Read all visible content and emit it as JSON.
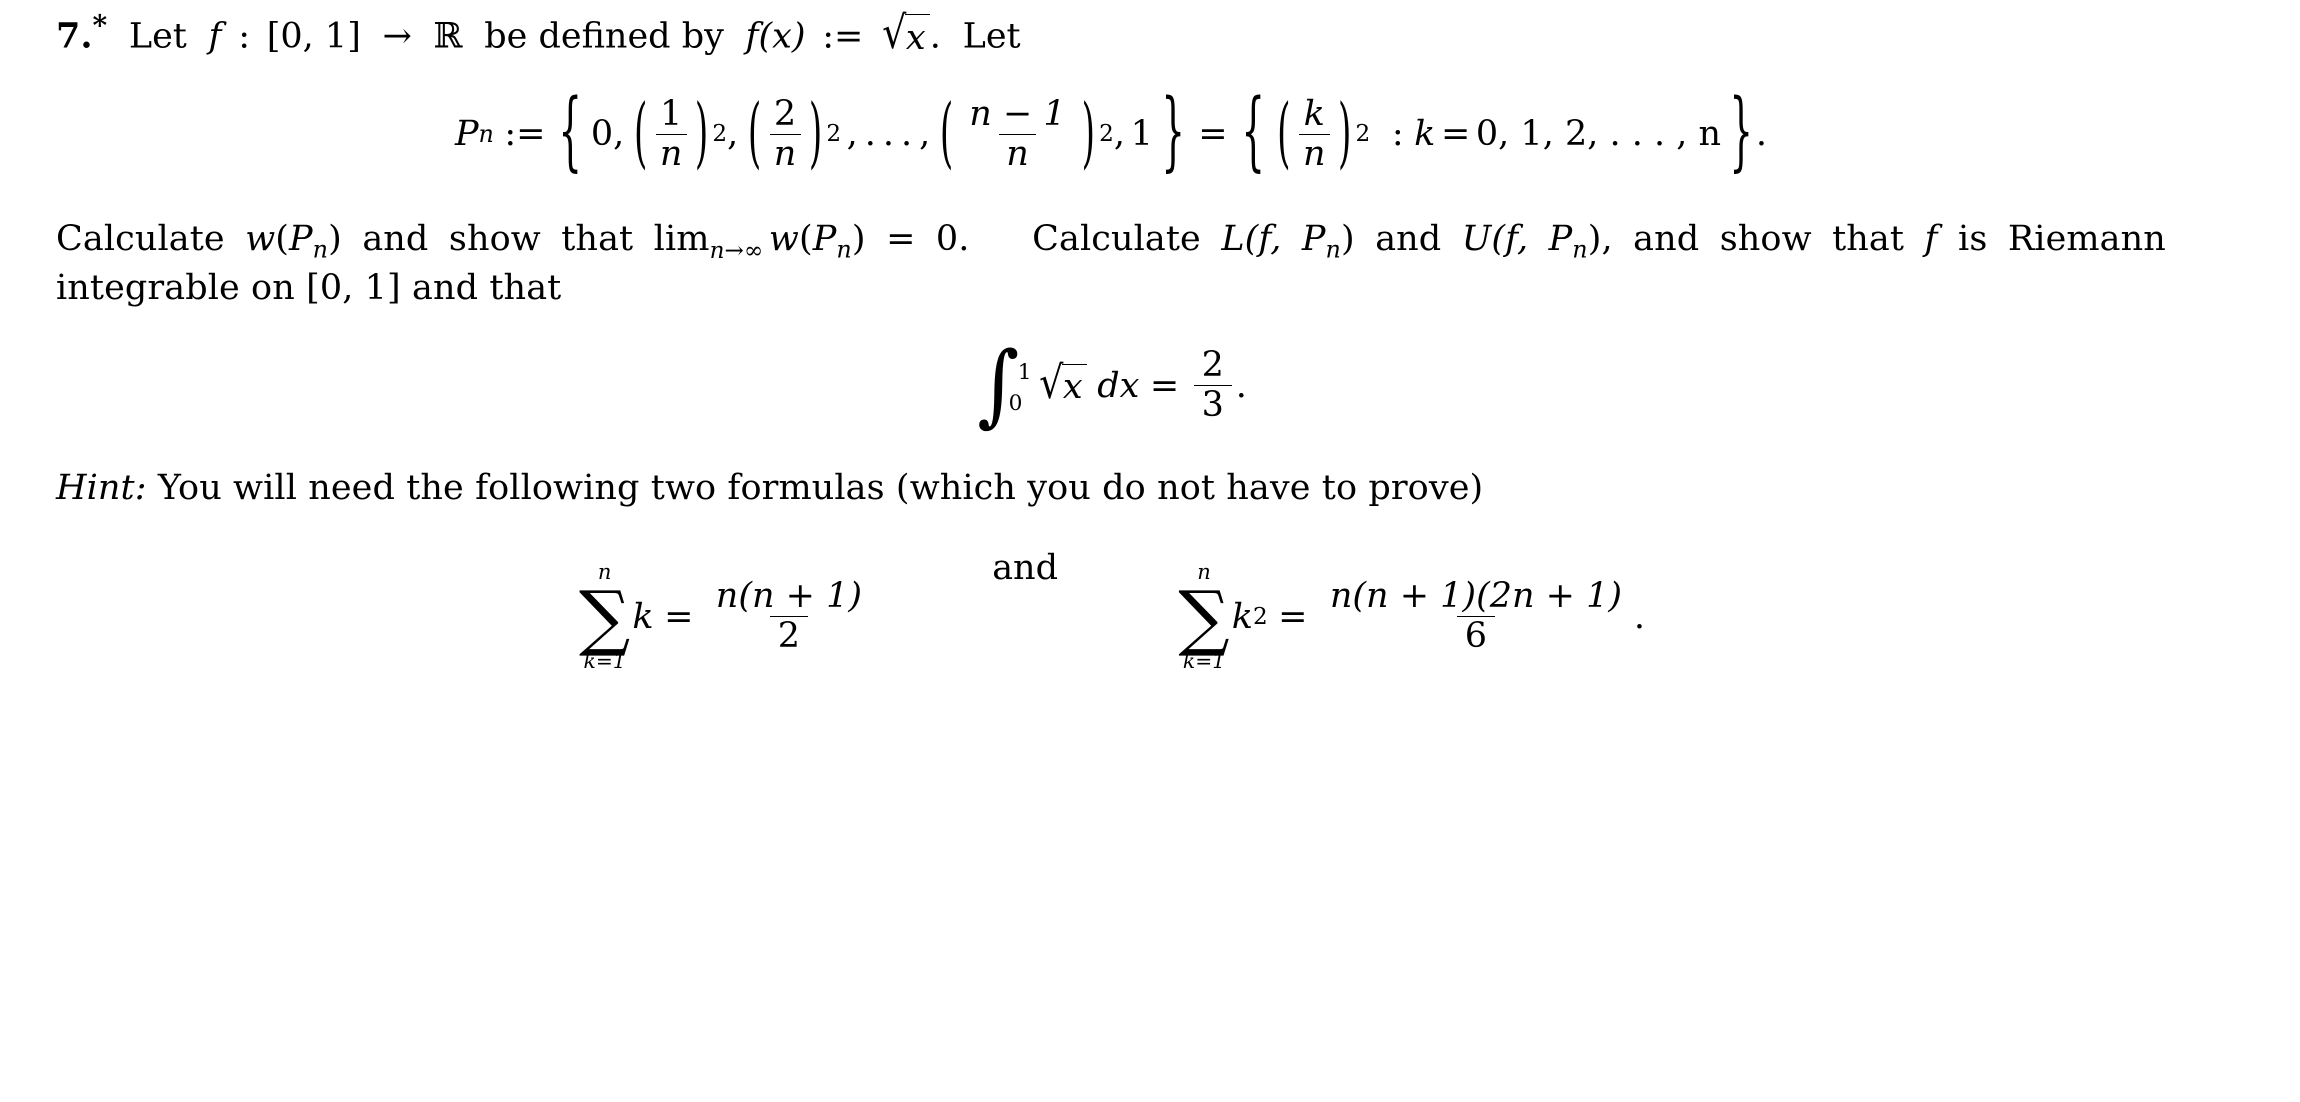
{
  "document": {
    "kind": "math-exercise",
    "item_number": "7.",
    "item_marker": "*"
  },
  "intro": {
    "let": "Let",
    "f": "f",
    "colon": ":",
    "domain": "[0, 1]",
    "arrow": "→",
    "codomain": "ℝ",
    "be_defined_by": "be defined by",
    "fx": "f(x)",
    "assign": ":=",
    "sqrt_body": "x",
    "period": ".",
    "let2": "Let"
  },
  "partition_eq": {
    "lhs_symbol": "P",
    "lhs_sub": "n",
    "assign": ":=",
    "open_brace": "{",
    "first_element": "0",
    "comma": ",",
    "term1_num": "1",
    "term1_den": "n",
    "term1_exp": "2",
    "term2_num": "2",
    "term2_den": "n",
    "term2_exp": "2",
    "ellipsis": ", . . . ,",
    "term3_num": "n − 1",
    "term3_den": "n",
    "term3_exp": "2",
    "last_element": "1",
    "close_brace": "}",
    "equals": "=",
    "set_num": "k",
    "set_den": "n",
    "set_exp": "2",
    "such_that": ":",
    "index_var": "k",
    "index_equals": "=",
    "index_values": "0, 1, 2, . . . , n",
    "period": "."
  },
  "body_paragraph": {
    "s1": "Calculate",
    "w": "w",
    "wp_open": "(",
    "P": "P",
    "P_sub": "n",
    "wp_close": ")",
    "s2": "and show that",
    "lim": "lim",
    "lim_sub": "n→∞",
    "s3": "= 0.",
    "s4": "Calculate",
    "L": "L",
    "L_args": "(f, P",
    "L_args_sub": "n",
    "L_close": ")",
    "s5": "and",
    "U": "U",
    "U_args": "(f, P",
    "U_args_sub": "n",
    "U_close": "),",
    "s6": "and show",
    "s7": "that",
    "f": "f",
    "s8": "is Riemann integrable on",
    "interval": "[0, 1]",
    "s9": "and that"
  },
  "integral_eq": {
    "int_glyph": "∫",
    "upper_limit": "1",
    "lower_limit": "0",
    "sqrt_body": "x",
    "differential": "dx",
    "equals": "=",
    "result_num": "2",
    "result_den": "3",
    "period": "."
  },
  "hint": {
    "label": "Hint:",
    "text": "You will need the following two formulas (which you do not have to prove)"
  },
  "formula_one": {
    "sum_glyph": "∑",
    "upper": "n",
    "lower": "k=1",
    "summand": "k",
    "equals": "=",
    "num": "n(n + 1)",
    "den": "2"
  },
  "conjunction": "and",
  "formula_two": {
    "sum_glyph": "∑",
    "upper": "n",
    "lower": "k=1",
    "summand": "k",
    "summand_exp": "2",
    "equals": "=",
    "num": "n(n + 1)(2n + 1)",
    "den": "6",
    "period": "."
  },
  "style": {
    "text_color": "#000000",
    "background": "#ffffff"
  }
}
